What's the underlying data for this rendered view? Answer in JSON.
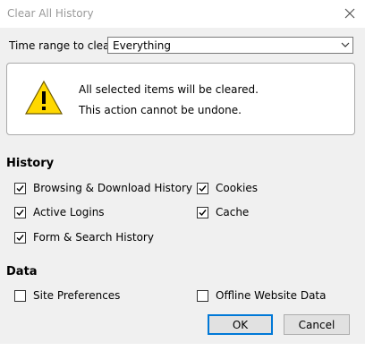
{
  "window": {
    "title": "Clear All History"
  },
  "time_range": {
    "label": "Time range to clear:",
    "value": "Everything"
  },
  "warning": {
    "line1": "All selected items will be cleared.",
    "line2": "This action cannot be undone."
  },
  "history": {
    "heading": "History",
    "items": [
      {
        "label": "Browsing & Download History",
        "checked": true
      },
      {
        "label": "Cookies",
        "checked": true
      },
      {
        "label": "Active Logins",
        "checked": true
      },
      {
        "label": "Cache",
        "checked": true
      },
      {
        "label": "Form & Search History",
        "checked": true
      }
    ]
  },
  "data": {
    "heading": "Data",
    "items": [
      {
        "label": "Site Preferences",
        "checked": false
      },
      {
        "label": "Offline Website Data",
        "checked": false
      }
    ]
  },
  "buttons": {
    "ok": "OK",
    "cancel": "Cancel"
  },
  "colors": {
    "accent": "#0078d7",
    "warning": "#ffd800"
  },
  "icons": [
    "close-icon",
    "chevron-down-icon",
    "warning-icon",
    "checkmark-icon"
  ]
}
